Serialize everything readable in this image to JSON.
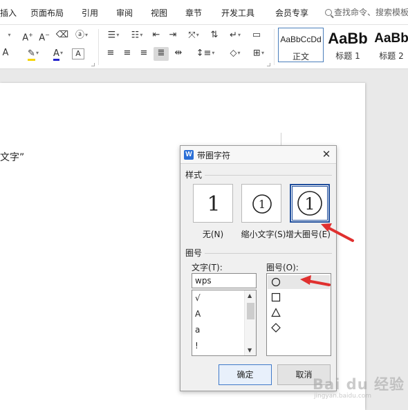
{
  "menu": {
    "items": [
      "插入",
      "页面布局",
      "引用",
      "审阅",
      "视图",
      "章节",
      "开发工具",
      "会员专享"
    ],
    "search_placeholder": "查找命令、搜索模板"
  },
  "ribbon": {
    "styles": [
      {
        "sample": "AaBbCcDd",
        "name": "正文"
      },
      {
        "sample": "AaBb",
        "name": "标题 1"
      },
      {
        "sample": "AaBb",
        "name": "标题 2"
      }
    ]
  },
  "document": {
    "visible_text": "文字”"
  },
  "dialog": {
    "title": "带圈字符",
    "close_glyph": "✕",
    "style_group_label": "样式",
    "style_options": [
      {
        "glyph": "1",
        "label": "无(N)",
        "selected": false
      },
      {
        "glyph": "①",
        "label": "缩小文字(S)",
        "selected": false
      },
      {
        "glyph": "①",
        "label": "增大圈号(E)",
        "selected": true
      }
    ],
    "enclosure_group_label": "圈号",
    "text_label": "文字(T):",
    "text_value": "wps",
    "char_list": [
      "√",
      "A",
      "a",
      "!"
    ],
    "enclosure_label": "圈号(O):",
    "enclosures": [
      {
        "shape": "circle",
        "selected": true
      },
      {
        "shape": "square",
        "selected": false
      },
      {
        "shape": "triangle",
        "selected": false
      },
      {
        "shape": "diamond",
        "selected": false
      }
    ],
    "ok_label": "确定",
    "cancel_label": "取消"
  },
  "annotations": {
    "arrow_color": "#e0302f"
  },
  "watermark": {
    "main": "Bai du 经验",
    "sub": "jingyan.baidu.com"
  }
}
